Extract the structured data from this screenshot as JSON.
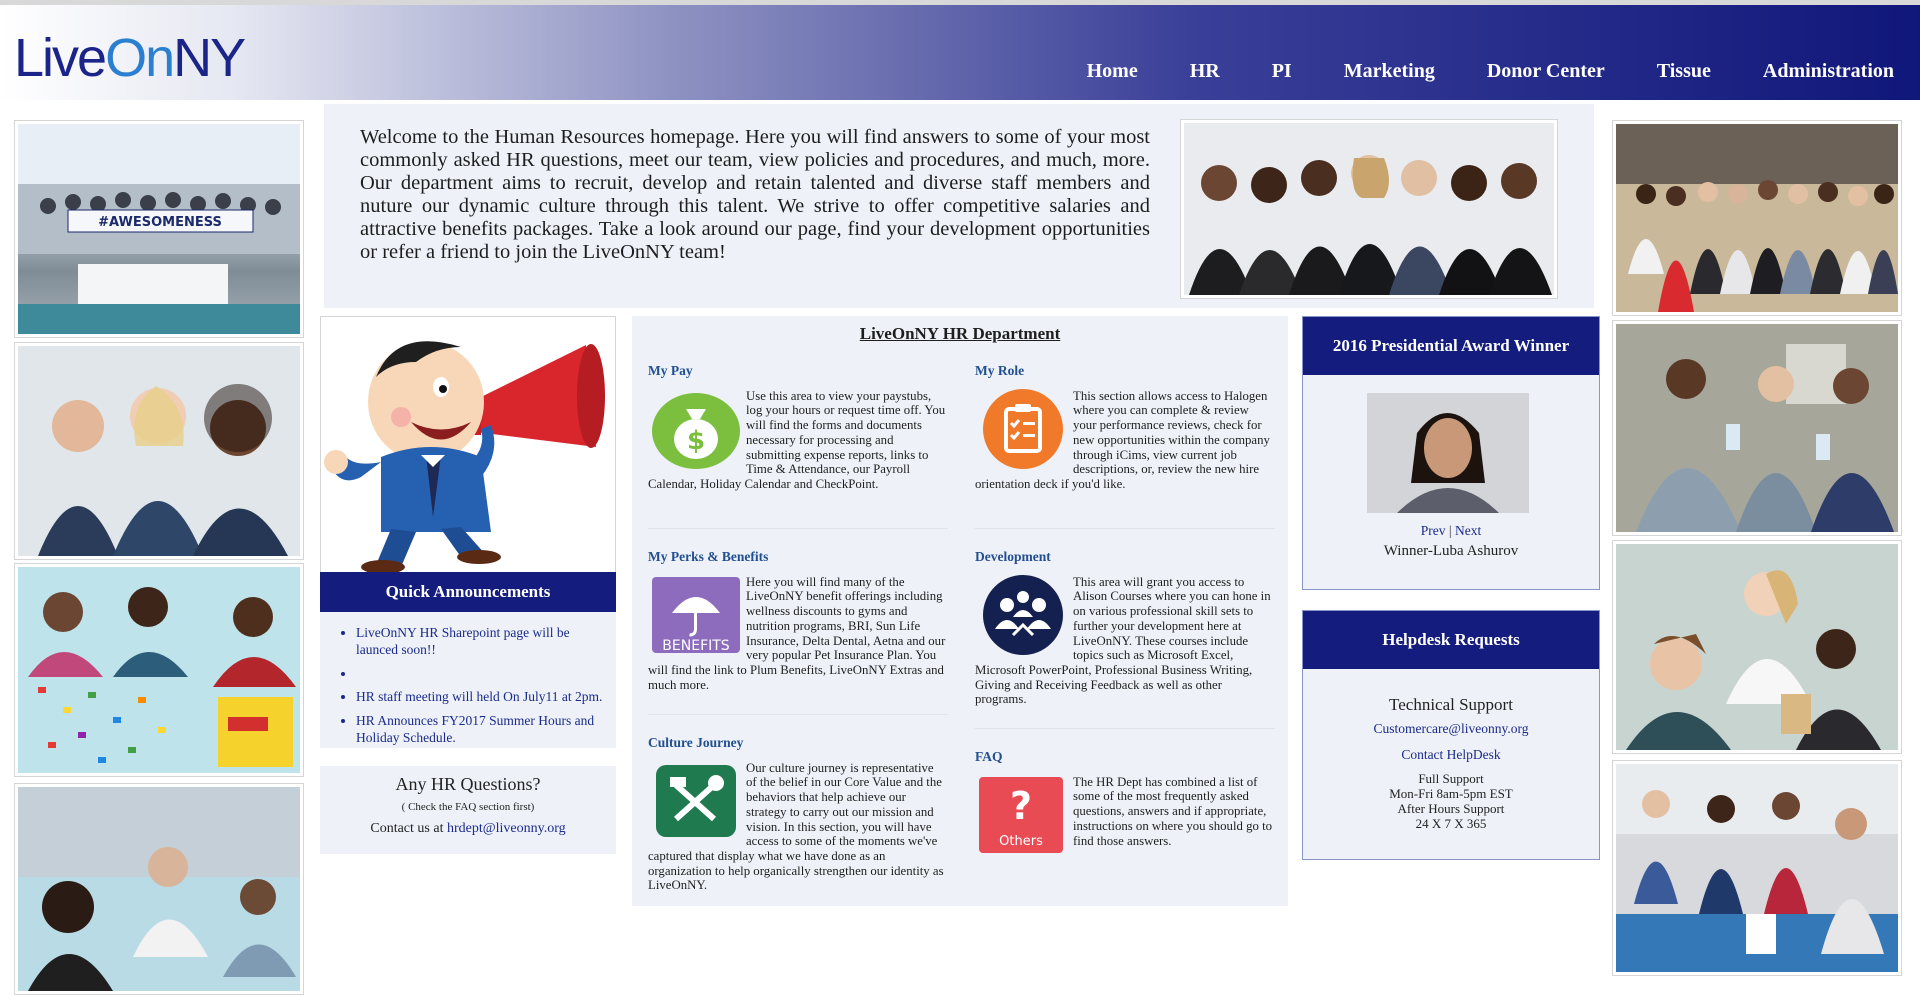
{
  "header": {
    "logo": {
      "part1": "Live",
      "part2": "On",
      "part3": "NY"
    },
    "nav": [
      "Home",
      "HR",
      "PI",
      "Marketing",
      "Donor Center",
      "Tissue",
      "Administration"
    ]
  },
  "welcome": {
    "text": "Welcome to the Human Resources homepage. Here you will find answers to some of your most commonly asked HR questions, meet our team, view policies and procedures, and much, more. Our department aims to recruit, develop and retain talented and diverse staff members and nuture our dynamic culture through this talent. We strive to offer competitive salaries and attractive benefits packages. Take a look around our page, find your development opportunities or refer a friend to join the LiveOnNY team!"
  },
  "left_photos": {
    "banner_text": "#AWESOMENESS"
  },
  "quick_announcements": {
    "title": "Quick Announcements",
    "items": [
      "LiveOnNY HR Sharepoint page will be launced soon!!",
      "",
      "HR staff meeting will held On July11 at 2pm.",
      "HR Announces FY2017 Summer Hours and Holiday Schedule."
    ]
  },
  "hr_questions": {
    "title": "Any HR Questions?",
    "note": "( Check the FAQ section first)",
    "contact_prefix": "Contact us at ",
    "email": "hrdept@liveonny.org"
  },
  "department": {
    "title": "LiveOnNY HR Department",
    "sections": [
      {
        "heading": "My Pay",
        "icon": "money-bag-icon",
        "text": "Use this area to view your paystubs, log your hours or request time off. You will find the forms and documents necessary for processing and submitting expense reports, links to Time & Attendance, our Payroll Calendar, Holiday Calendar and CheckPoint."
      },
      {
        "heading": "My Role",
        "icon": "clipboard-icon",
        "text": "This section allows access to Halogen where you can complete & review your performance reviews, check for new opportunities within the company through iCims, view current job descriptions, or, review the new hire orientation deck if you'd like."
      },
      {
        "heading": "My Perks & Benefits",
        "icon": "umbrella-icon",
        "icon_label": "BENEFITS",
        "text": "Here you will find many of the LiveOnNY benefit offerings including wellness discounts to gyms and nutrition programs, BRI, Sun Life Insurance, Delta Dental, Aetna and our very popular Pet Insurance Plan. You will find the link to Plum Benefits, LiveOnNY Extras and much more."
      },
      {
        "heading": "Development",
        "icon": "team-icon",
        "text": "This area will grant you access to Alison Courses where you can hone in on various professional skill sets to further your development here at LiveOnNY. These courses include topics such as Microsoft Excel, Microsoft PowerPoint, Professional Business Writing, Giving and Receiving Feedback as well as other programs."
      },
      {
        "heading": "Culture Journey",
        "icon": "tools-icon",
        "text": "Our culture journey is representative of the belief in our Core Value and the behaviors that help achieve our strategy to carry out our mission and vision. In this section, you will have access to some of the moments we've captured that display what we have done as an organization to help organically strengthen our identity as LiveOnNY."
      },
      {
        "heading": "FAQ",
        "icon": "question-icon",
        "icon_label": "Others",
        "text": "The HR Dept has combined a list of some of the most frequently asked questions, answers and if appropriate, instructions on where you should go to find those answers."
      }
    ]
  },
  "award": {
    "title": "2016 Presidential Award Winner",
    "prev": "Prev",
    "separator": "|",
    "next": "Next",
    "winner": "Winner-Luba Ashurov"
  },
  "helpdesk": {
    "title": "Helpdesk Requests",
    "subtitle": "Technical Support",
    "email": "Customercare@liveonny.org",
    "contact": "Contact HelpDesk",
    "lines": [
      "Full Support",
      "Mon-Fri 8am-5pm EST",
      "After Hours Support",
      "24 X 7 X 365"
    ]
  },
  "colors": {
    "nav_dark": "#10177a",
    "bar_blue": "#141d7e",
    "panel_bg": "#eef2f8",
    "link": "#1b2a8a",
    "pay_green": "#7cbf3e",
    "role_orange": "#f07a2a",
    "benefits_purple": "#8d6bbd",
    "dev_navy": "#14204f",
    "culture_green": "#1f7a4f",
    "faq_red": "#e84b54"
  }
}
